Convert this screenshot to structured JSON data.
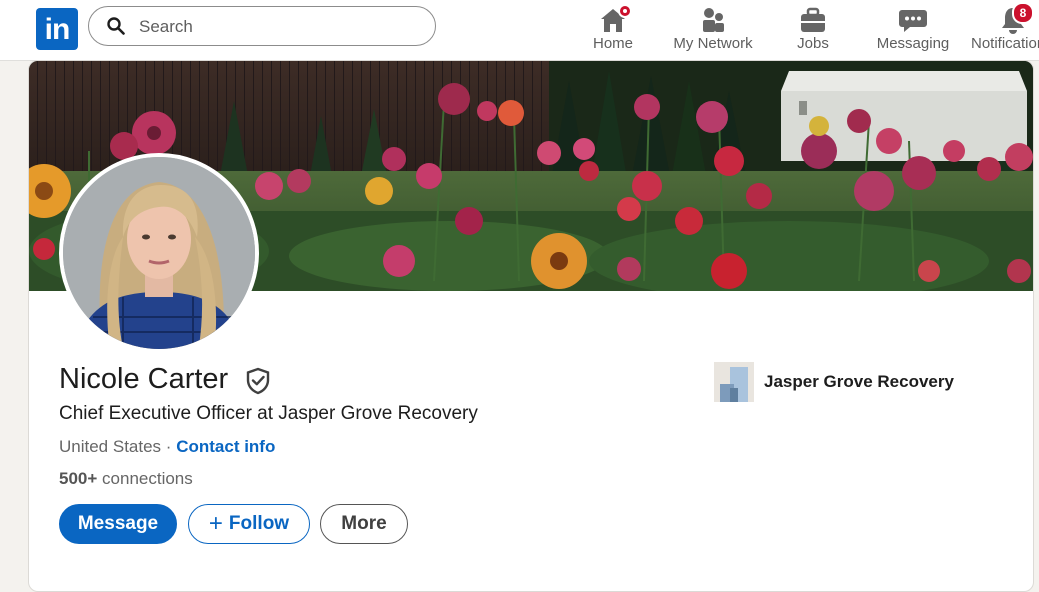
{
  "nav": {
    "search_placeholder": "Search",
    "items": [
      {
        "label": "Home",
        "icon": "home-icon",
        "badge": ""
      },
      {
        "label": "My Network",
        "icon": "people-icon",
        "badge": ""
      },
      {
        "label": "Jobs",
        "icon": "briefcase-icon",
        "badge": ""
      },
      {
        "label": "Messaging",
        "icon": "chat-icon",
        "badge": ""
      },
      {
        "label": "Notifications",
        "icon": "bell-icon",
        "badge": "8"
      }
    ]
  },
  "profile": {
    "name": "Nicole Carter",
    "headline": "Chief Executive Officer at Jasper Grove Recovery",
    "location": "United States",
    "separator": "·",
    "contact_info": "Contact info",
    "connections_count": "500+",
    "connections_label": "connections",
    "company": "Jasper Grove Recovery"
  },
  "actions": {
    "message": "Message",
    "follow_plus": "+",
    "follow": "Follow",
    "more": "More"
  },
  "colors": {
    "brand": "#0a66c2",
    "badge": "#cb112d"
  }
}
